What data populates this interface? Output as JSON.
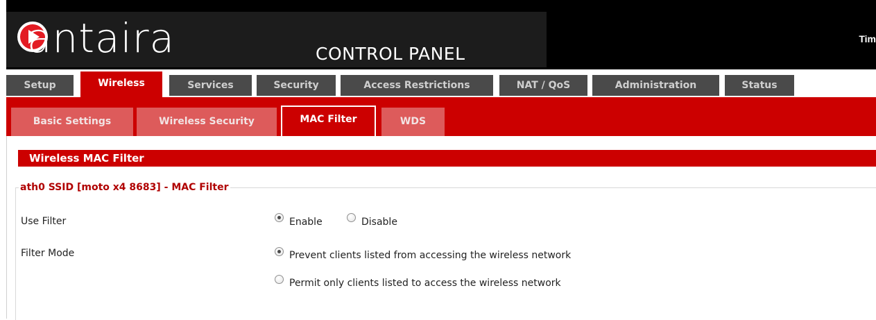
{
  "header": {
    "logo_text": "antaira",
    "title": "CONTROL PANEL",
    "time_label": "Tim"
  },
  "main_tabs": [
    {
      "label": "Setup",
      "active": false
    },
    {
      "label": "Wireless",
      "active": true
    },
    {
      "label": "Services",
      "active": false
    },
    {
      "label": "Security",
      "active": false
    },
    {
      "label": "Access Restrictions",
      "active": false
    },
    {
      "label": "NAT / QoS",
      "active": false
    },
    {
      "label": "Administration",
      "active": false
    },
    {
      "label": "Status",
      "active": false
    }
  ],
  "sub_tabs": [
    {
      "label": "Basic Settings",
      "active": false
    },
    {
      "label": "Wireless Security",
      "active": false
    },
    {
      "label": "MAC Filter",
      "active": true
    },
    {
      "label": "WDS",
      "active": false
    }
  ],
  "section": {
    "title": "Wireless MAC Filter",
    "legend": "ath0 SSID [moto x4 8683] - MAC Filter",
    "use_filter": {
      "label": "Use Filter",
      "options": [
        {
          "label": "Enable",
          "checked": true
        },
        {
          "label": "Disable",
          "checked": false
        }
      ]
    },
    "filter_mode": {
      "label": "Filter Mode",
      "options": [
        {
          "label": "Prevent clients listed from accessing the wireless network",
          "checked": true
        },
        {
          "label": "Permit only clients listed to access the wireless network",
          "checked": false
        }
      ]
    }
  },
  "colors": {
    "accent_red": "#cc0000",
    "inactive_subtab": "#dd5b5b",
    "inactive_maintab": "#4a4a4a",
    "header_bg": "#000000"
  },
  "icons": [
    "logo-play-icon"
  ]
}
